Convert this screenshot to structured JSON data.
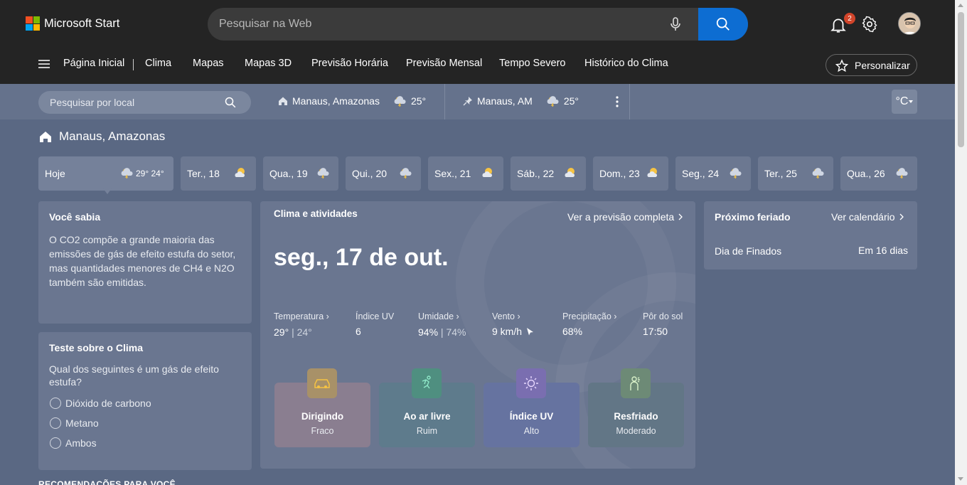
{
  "header": {
    "brand": "Microsoft Start",
    "search_placeholder": "Pesquisar na Web",
    "notification_count": "2"
  },
  "nav": {
    "items": [
      "Página Inicial",
      "Clima",
      "Mapas",
      "Mapas 3D",
      "Previsão Horária",
      "Previsão Mensal",
      "Tempo Severo",
      "Histórico do Clima"
    ],
    "personalize_label": "Personalizar"
  },
  "location_bar": {
    "search_placeholder": "Pesquisar por local",
    "home_location": "Manaus, Amazonas",
    "home_temp": "25°",
    "pinned_location": "Manaus, AM",
    "pinned_temp": "25°",
    "unit": "°C"
  },
  "location_title": "Manaus, Amazonas",
  "days": [
    {
      "label": "Hoje",
      "temps": "29° 24°",
      "icon": "thunderstorm-icon"
    },
    {
      "label": "Ter., 18",
      "icon": "partly-sunny-icon"
    },
    {
      "label": "Qua., 19",
      "icon": "thunderstorm-icon"
    },
    {
      "label": "Qui., 20",
      "icon": "thunderstorm-icon"
    },
    {
      "label": "Sex., 21",
      "icon": "partly-sunny-icon"
    },
    {
      "label": "Sáb., 22",
      "icon": "partly-sunny-icon"
    },
    {
      "label": "Dom., 23",
      "icon": "partly-sunny-icon"
    },
    {
      "label": "Seg., 24",
      "icon": "thunderstorm-icon"
    },
    {
      "label": "Ter., 25",
      "icon": "thunderstorm-icon"
    },
    {
      "label": "Qua., 26",
      "icon": "thunderstorm-icon"
    }
  ],
  "did_you_know": {
    "title": "Você sabia",
    "text": "O CO2 compõe a grande maioria das emissões de gás de efeito estufa do setor, mas quantidades menores de CH4 e N2O também são emitidas."
  },
  "quiz": {
    "title": "Teste sobre o Clima",
    "question": "Qual dos seguintes é um gás de efeito estufa?",
    "options": [
      "Dióxido de carbono",
      "Metano",
      "Ambos"
    ]
  },
  "activities_card": {
    "title": "Clima e atividades",
    "link": "Ver a previsão completa",
    "date": "seg., 17 de out.",
    "stats": {
      "temperature": {
        "label": "Temperatura",
        "high": "29°",
        "low": "24°"
      },
      "uv": {
        "label": "Índice UV",
        "value": "6"
      },
      "humidity": {
        "label": "Umidade",
        "high": "94%",
        "low": "74%"
      },
      "wind": {
        "label": "Vento",
        "value": "9 km/h"
      },
      "precip": {
        "label": "Precipitação",
        "value": "68%"
      },
      "sunset": {
        "label": "Pôr do sol",
        "value": "17:50"
      }
    },
    "activities": [
      {
        "name": "Dirigindo",
        "level": "Fraco",
        "icon": "car-icon",
        "bg": "#8a7e90",
        "icon_bg": "#a89168"
      },
      {
        "name": "Ao ar livre",
        "level": "Ruim",
        "icon": "running-person-icon",
        "bg": "#5e7b8c",
        "icon_bg": "#4f8f80"
      },
      {
        "name": "Índice UV",
        "level": "Alto",
        "icon": "sun-icon",
        "bg": "#6673a0",
        "icon_bg": "#7a6eb0"
      },
      {
        "name": "Resfriado",
        "level": "Moderado",
        "icon": "sneezing-person-icon",
        "bg": "#627686",
        "icon_bg": "#6d8a76"
      }
    ]
  },
  "holiday": {
    "title": "Próximo feriado",
    "link": "Ver calendário",
    "name": "Dia de Finados",
    "when": "Em 16 dias"
  },
  "recommendations_heading": "RECOMENDAÇÕES PARA VOCÊ",
  "colors": {
    "page_bg": "#5a6883",
    "topbar_bg": "#242424",
    "search_button": "#0d6dd2",
    "card_bg": "#6a7690"
  }
}
